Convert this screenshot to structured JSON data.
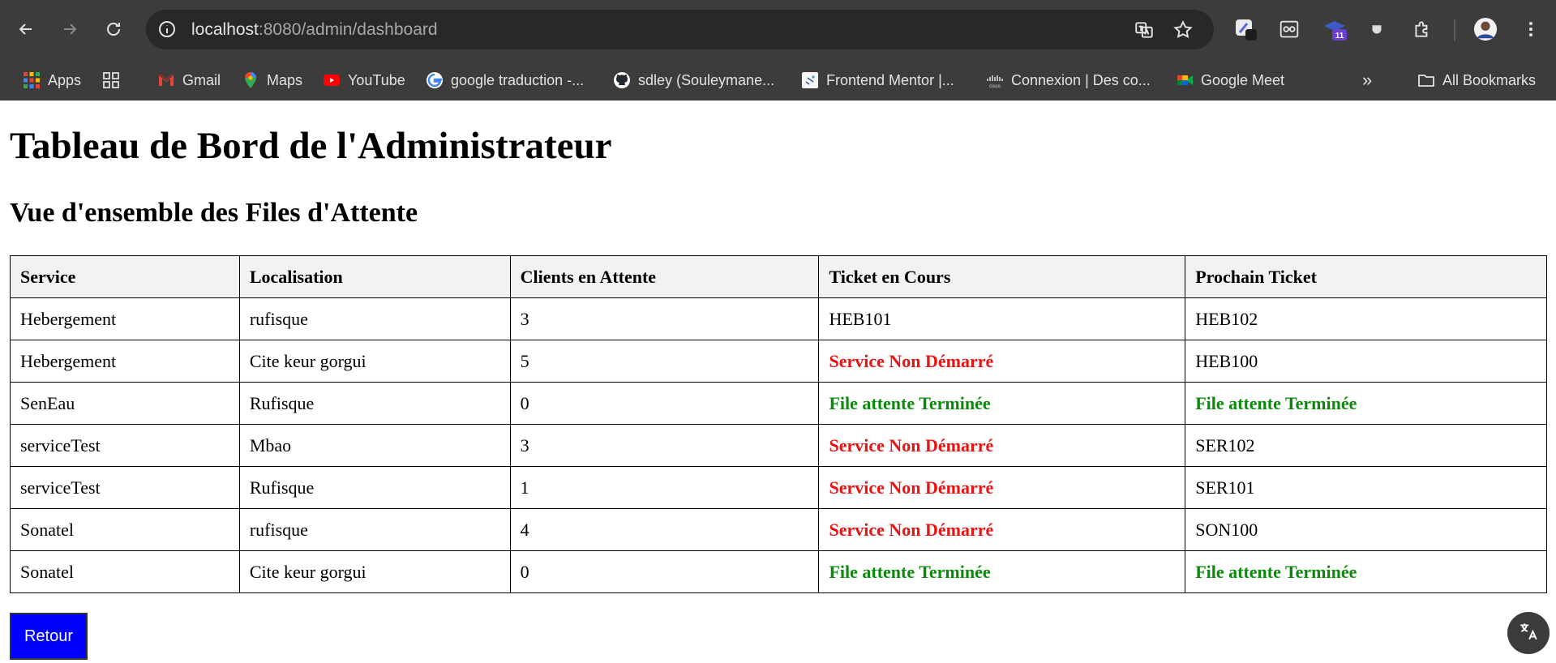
{
  "browser": {
    "url_host": "localhost",
    "url_rest": ":8080/admin/dashboard",
    "extension_badge": "11",
    "bookmarks": [
      {
        "label": "Apps",
        "icon": "apps-grid-icon"
      },
      {
        "label": "",
        "icon": "tab-groups-icon"
      },
      {
        "label": "Gmail",
        "icon": "gmail-icon"
      },
      {
        "label": "Maps",
        "icon": "maps-pin-icon"
      },
      {
        "label": "YouTube",
        "icon": "youtube-icon"
      },
      {
        "label": "google traduction -...",
        "icon": "google-g-icon"
      },
      {
        "label": "sdley (Souleymane...",
        "icon": "github-icon"
      },
      {
        "label": "Frontend Mentor |...",
        "icon": "frontend-mentor-icon"
      },
      {
        "label": "Connexion | Des co...",
        "icon": "cisco-icon"
      },
      {
        "label": "Google Meet",
        "icon": "google-meet-icon"
      }
    ],
    "overflow_label": "»",
    "all_bookmarks": "All Bookmarks"
  },
  "page": {
    "title": "Tableau de Bord de l'Administrateur",
    "subtitle": "Vue d'ensemble des Files d'Attente",
    "table": {
      "headers": [
        "Service",
        "Localisation",
        "Clients en Attente",
        "Ticket en Cours",
        "Prochain Ticket"
      ],
      "rows": [
        {
          "service": "Hebergement",
          "localisation": "rufisque",
          "clients": "3",
          "current": "HEB101",
          "current_status": "normal",
          "next": "HEB102",
          "next_status": "normal"
        },
        {
          "service": "Hebergement",
          "localisation": "Cite keur gorgui",
          "clients": "5",
          "current": "Service Non Démarré",
          "current_status": "not-started",
          "next": "HEB100",
          "next_status": "normal"
        },
        {
          "service": "SenEau",
          "localisation": "Rufisque",
          "clients": "0",
          "current": "File attente Terminée",
          "current_status": "finished",
          "next": "File attente Terminée",
          "next_status": "finished"
        },
        {
          "service": "serviceTest",
          "localisation": "Mbao",
          "clients": "3",
          "current": "Service Non Démarré",
          "current_status": "not-started",
          "next": "SER102",
          "next_status": "normal"
        },
        {
          "service": "serviceTest",
          "localisation": "Rufisque",
          "clients": "1",
          "current": "Service Non Démarré",
          "current_status": "not-started",
          "next": "SER101",
          "next_status": "normal"
        },
        {
          "service": "Sonatel",
          "localisation": "rufisque",
          "clients": "4",
          "current": "Service Non Démarré",
          "current_status": "not-started",
          "next": "SON100",
          "next_status": "normal"
        },
        {
          "service": "Sonatel",
          "localisation": "Cite keur gorgui",
          "clients": "0",
          "current": "File attente Terminée",
          "current_status": "finished",
          "next": "File attente Terminée",
          "next_status": "finished"
        }
      ]
    },
    "back_button": "Retour"
  },
  "colors": {
    "chrome_bg": "#3c3c3c",
    "status_not_started": "#ee1111",
    "status_finished": "#0a8a0a",
    "back_button_bg": "#0000ff"
  }
}
